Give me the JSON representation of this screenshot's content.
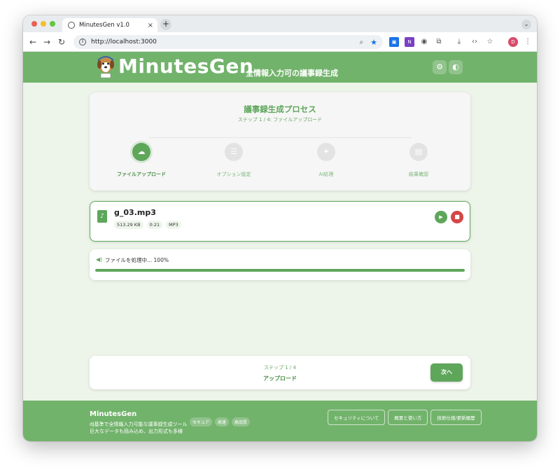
{
  "browser": {
    "tab_title": "MinutesGen v1.0",
    "tab_close": "×",
    "new_tab": "+",
    "tab_menu": "⌄",
    "url": "http://localhost:3000",
    "profile_initial": "D"
  },
  "header": {
    "brand": "MinutesGen",
    "tagline": "全情報入力可の議事録生成",
    "settings_icon": "⚙",
    "theme_icon": "◐"
  },
  "process": {
    "title": "議事録生成プロセス",
    "subtitle": "ステップ 1 / 4: ファイルアップロード",
    "steps": [
      {
        "label": "ファイルアップロード",
        "icon": "☁",
        "active": true
      },
      {
        "label": "オプション設定",
        "icon": "☰",
        "active": false
      },
      {
        "label": "AI処理",
        "icon": "✦",
        "active": false
      },
      {
        "label": "結果確認",
        "icon": "▤",
        "active": false
      }
    ]
  },
  "file": {
    "name": "g_03.mp3",
    "size": "513.29 KB",
    "duration": "0:21",
    "format": "MP3"
  },
  "progress": {
    "text": "ファイルを処理中... 100%",
    "value": 1.0
  },
  "nav": {
    "step": "ステップ 1 / 4",
    "step_name": "アップロード",
    "next_label": "次へ"
  },
  "footer": {
    "brand": "MinutesGen",
    "desc_line1": "dJ基準で全情報入力可能な議事録生成ツール",
    "desc_line2": "巨大なデータも読み込め、出力形式も多様",
    "badges": [
      "セキュア",
      "高速",
      "高品質"
    ],
    "links": [
      "セキュリティについて",
      "概要と使い方",
      "技術仕様/更新履歴"
    ]
  },
  "colors": {
    "brand_green": "#72b36c",
    "accent_green": "#5ea65a",
    "danger_red": "#d64545"
  }
}
